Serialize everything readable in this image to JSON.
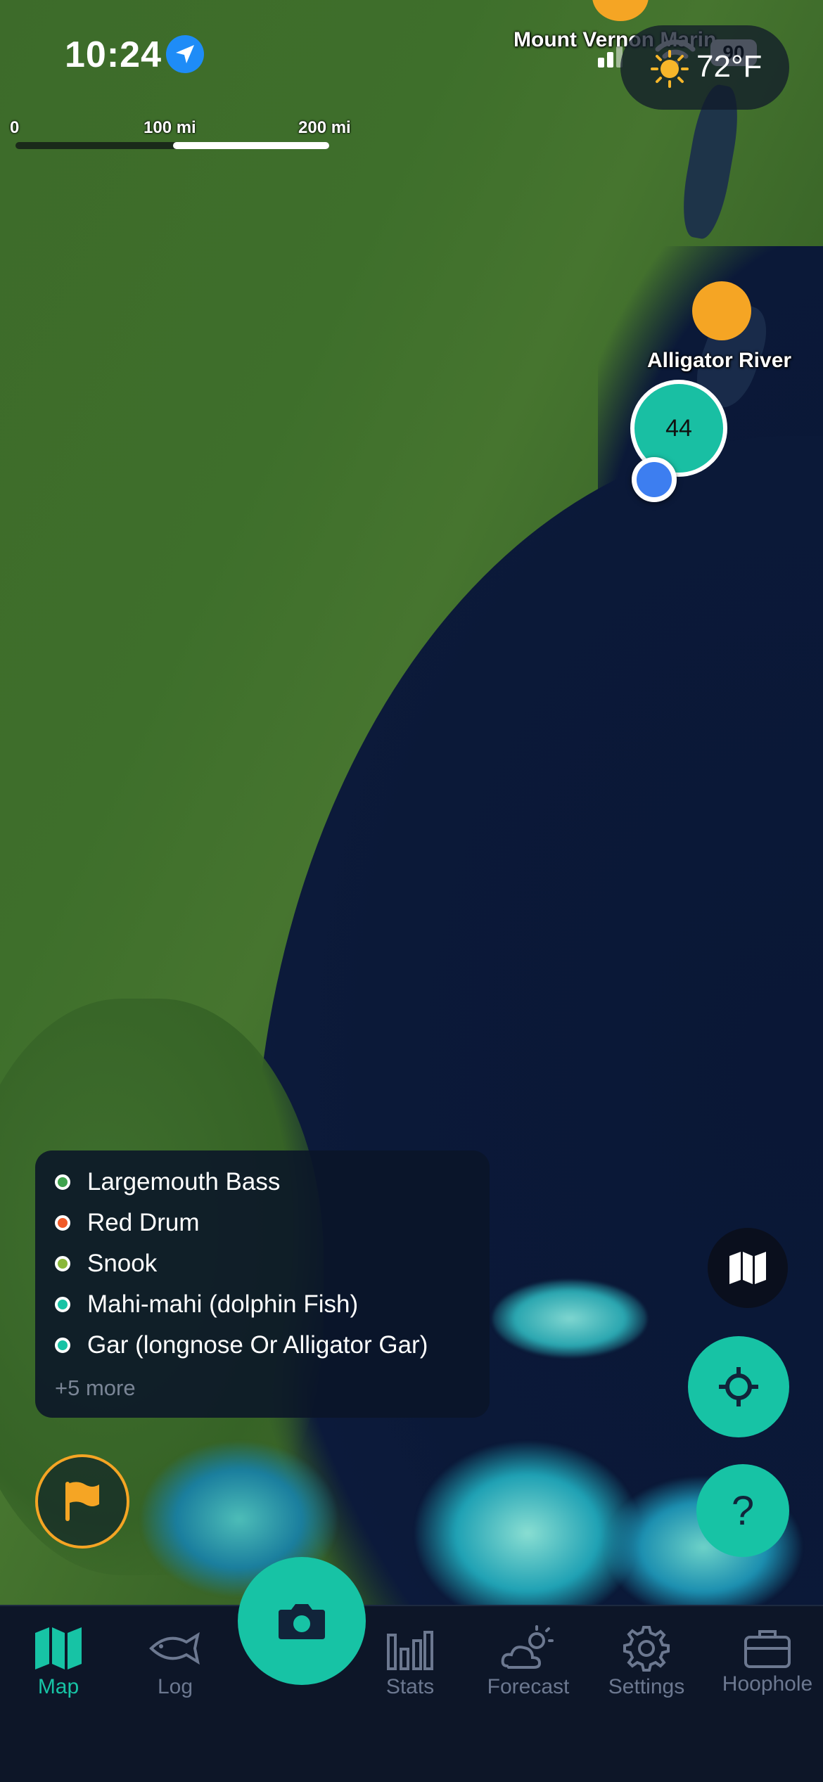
{
  "status_bar": {
    "time": "10:24",
    "battery": "90"
  },
  "weather": {
    "temperature": "72°F",
    "icon": "sun-cloud-icon"
  },
  "scale": {
    "labels": [
      "0",
      "100 mi",
      "200 mi"
    ]
  },
  "map": {
    "labels": {
      "top": "Mount Vernon Marin",
      "alligator": "Alligator River"
    },
    "cluster_count": "44",
    "colors": {
      "cluster": "#19bfa3",
      "spot_marker": "#f5a524",
      "user_location": "#3d7ef0"
    }
  },
  "legend": {
    "items": [
      {
        "label": "Largemouth Bass",
        "color": "#3fa34d"
      },
      {
        "label": "Red Drum",
        "color": "#f05a28"
      },
      {
        "label": "Snook",
        "color": "#8ab839"
      },
      {
        "label": "Mahi-mahi (dolphin Fish)",
        "color": "#17c3a5"
      },
      {
        "label": "Gar (longnose Or Alligator Gar)",
        "color": "#17c3a5"
      }
    ],
    "more": "+5 more"
  },
  "fabs": {
    "map_layers": "map-layers-icon",
    "locate": "crosshair-icon",
    "help": "?",
    "flag": "flag-icon"
  },
  "tabs": {
    "map": "Map",
    "log": "Log",
    "stats": "Stats",
    "forecast": "Forecast",
    "settings": "Settings",
    "hoophole": "Hoophole"
  },
  "accent_color": "#17c3a5"
}
